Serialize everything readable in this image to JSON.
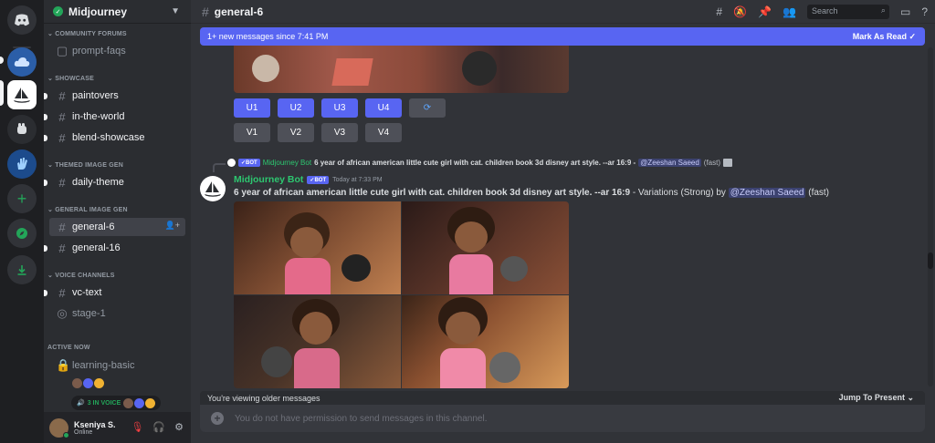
{
  "guild": {
    "name": "Midjourney"
  },
  "sidebar": {
    "categories": {
      "community": "COMMUNITY FORUMS",
      "showcase": "SHOWCASE",
      "themed": "THEMED IMAGE GEN",
      "general": "GENERAL IMAGE GEN",
      "voice": "VOICE CHANNELS",
      "active": "ACTIVE NOW"
    },
    "channels": {
      "prompt_faqs": "prompt-faqs",
      "paintovers": "paintovers",
      "in_the_world": "in-the-world",
      "blend_showcase": "blend-showcase",
      "daily_theme": "daily-theme",
      "general_6": "general-6",
      "general_16": "general-16",
      "vc_text": "vc-text",
      "stage_1": "stage-1",
      "learning_basic": "learning-basic"
    },
    "voice_badge": "3 IN VOICE"
  },
  "user": {
    "name": "Kseniya S.",
    "status": "Online"
  },
  "header": {
    "channel": "general-6",
    "search_placeholder": "Search"
  },
  "banner": {
    "text": "1+ new messages since 7:41 PM",
    "action": "Mark As Read"
  },
  "buttons": {
    "upscale": [
      "U1",
      "U2",
      "U3",
      "U4"
    ],
    "variation": [
      "V1",
      "V2",
      "V3",
      "V4"
    ]
  },
  "reply": {
    "author": "Midjourney Bot",
    "tag": "BOT",
    "text": "6 year of african american little cute girl with cat. children book 3d disney art style. --ar 16:9 -",
    "mention": "@Zeeshan Saeed",
    "suffix": "(fast)"
  },
  "message": {
    "author": "Midjourney Bot",
    "tag": "BOT",
    "time": "Today at 7:33 PM",
    "prompt": "6 year of african american little cute girl with cat. children book 3d disney art style. --ar 16:9",
    "variation": "- Variations (Strong) by",
    "mention": "@Zeeshan Saeed",
    "suffix": "(fast)"
  },
  "older": {
    "text": "You're viewing older messages",
    "jump": "Jump To Present"
  },
  "composer": {
    "placeholder": "You do not have permission to send messages in this channel."
  },
  "colors": {
    "accent": "#5865f2",
    "bot_name": "#2dc770",
    "online": "#23a559"
  }
}
